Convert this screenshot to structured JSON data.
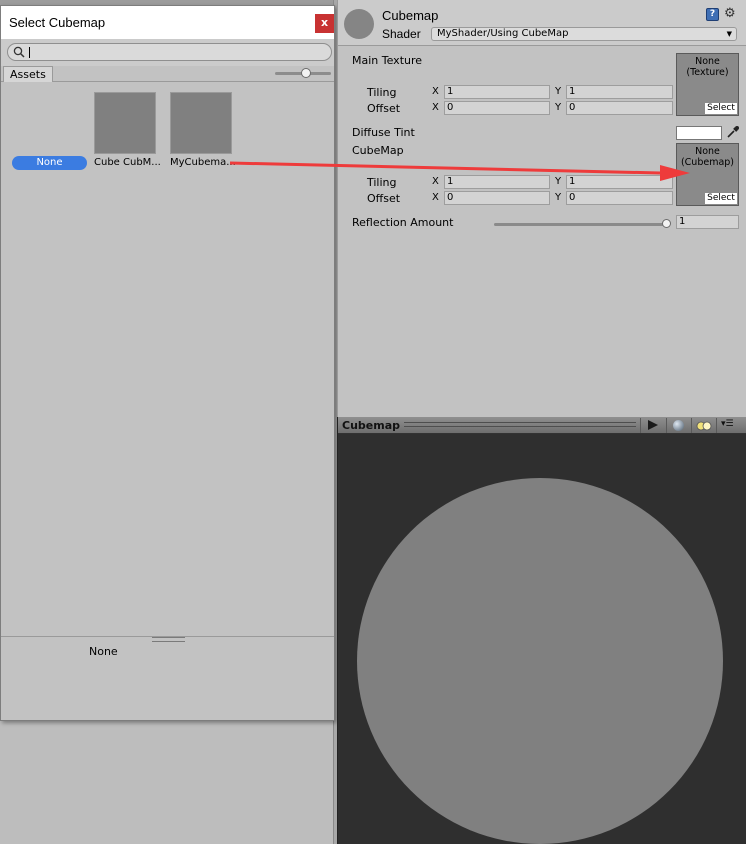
{
  "picker": {
    "title": "Select Cubemap",
    "close_label": "x",
    "tab_label": "Assets",
    "assets": [
      {
        "label": "None",
        "selected": true
      },
      {
        "label": "Cube CubM..."
      },
      {
        "label": "MyCubema..."
      }
    ],
    "preview_text": "None"
  },
  "inspector": {
    "material_name": "Cubemap",
    "shader_label": "Shader",
    "shader_value": "MyShader/Using CubeMap",
    "main_texture": {
      "label": "Main Texture",
      "slot_text_1": "None",
      "slot_text_2": "(Texture)",
      "select_label": "Select",
      "tiling_label": "Tiling",
      "offset_label": "Offset",
      "tiling_x": "1",
      "tiling_y": "1",
      "offset_x": "0",
      "offset_y": "0"
    },
    "diffuse_tint": {
      "label": "Diffuse Tint",
      "color": "#ffffff"
    },
    "cubemap": {
      "label": "CubeMap",
      "slot_text_1": "None",
      "slot_text_2": "(Cubemap)",
      "select_label": "Select",
      "tiling_label": "Tiling",
      "offset_label": "Offset",
      "tiling_x": "1",
      "tiling_y": "1",
      "offset_x": "0",
      "offset_y": "0"
    },
    "reflection": {
      "label": "Reflection Amount",
      "value": "1"
    },
    "x_letter": "X",
    "y_letter": "Y"
  },
  "preview": {
    "title": "Cubemap"
  },
  "colors": {
    "accent": "#3b7ce1",
    "close_button": "#c83232",
    "annotation_arrow": "#ee3b3b",
    "sphere": "#808080",
    "preview_bg": "#2f2f2f"
  }
}
